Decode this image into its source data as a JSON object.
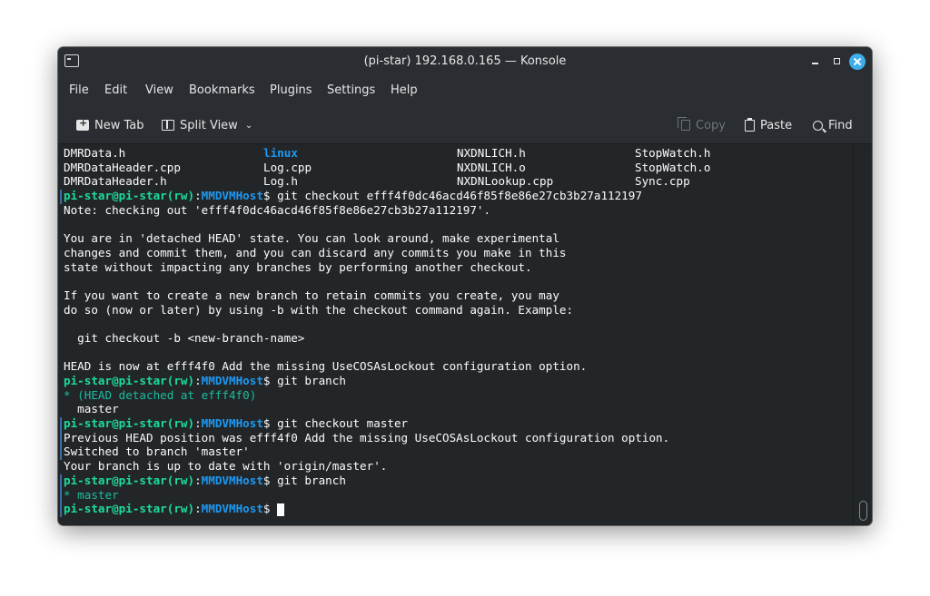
{
  "window": {
    "title": "(pi-star) 192.168.0.165 — Konsole"
  },
  "menu": [
    "File",
    "Edit",
    "View",
    "Bookmarks",
    "Plugins",
    "Settings",
    "Help"
  ],
  "toolbar": {
    "new_tab": "New Tab",
    "split_view": "Split View",
    "copy": "Copy",
    "paste": "Paste",
    "find": "Find"
  },
  "terminal": {
    "ls_rows": [
      [
        "DMRData.h",
        "linux",
        "NXDNLICH.h",
        "StopWatch.h"
      ],
      [
        "DMRDataHeader.cpp",
        "Log.cpp",
        "NXDNLICH.o",
        "StopWatch.o"
      ],
      [
        "DMRDataHeader.h",
        "Log.h",
        "NXDNLookup.cpp",
        "Sync.cpp"
      ]
    ],
    "prompt": {
      "user": "pi-star@pi-star(rw)",
      "sep": ":",
      "dir": "MMDVMHost",
      "symbol": "$"
    },
    "cmd_checkout": " git checkout efff4f0dc46acd46f85f8e86e27cb3b27a112197",
    "out_note": "Note: checking out 'efff4f0dc46acd46f85f8e86e27cb3b27a112197'.",
    "out_detached_1": "You are in 'detached HEAD' state. You can look around, make experimental",
    "out_detached_2": "changes and commit them, and you can discard any commits you make in this",
    "out_detached_3": "state without impacting any branches by performing another checkout.",
    "out_newbranch_1": "If you want to create a new branch to retain commits you create, you may",
    "out_newbranch_2": "do so (now or later) by using -b with the checkout command again. Example:",
    "out_example": "  git checkout -b <new-branch-name>",
    "out_head": "HEAD is now at efff4f0 Add the missing UseCOSAsLockout configuration option.",
    "cmd_branch": " git branch",
    "branch_detached": "* (HEAD detached at efff4f0)",
    "branch_master": "  master",
    "cmd_checkout_master": " git checkout master",
    "out_prev_head": "Previous HEAD position was efff4f0 Add the missing UseCOSAsLockout configuration option.",
    "out_switched": "Switched to branch 'master'",
    "out_uptodate": "Your branch is up to date with 'origin/master'.",
    "branch_current": "* master"
  },
  "colors": {
    "prompt_user": "#1cdc9a",
    "prompt_dir": "#1d99f3",
    "accent": "#3daee9"
  }
}
